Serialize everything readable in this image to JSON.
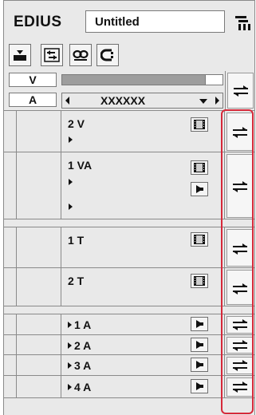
{
  "app": {
    "logo": "EDIUS",
    "sequence_name": "Untitled"
  },
  "toolbar": {
    "buttons": [
      "insert-mode-icon",
      "sync-lock-icon",
      "link-icon",
      "magnet-icon"
    ]
  },
  "source_channel": {
    "v_label": "V",
    "a_label": "A",
    "selected_source": "XXXXXX"
  },
  "tracks": [
    {
      "name": "2 V",
      "type": "V",
      "has_video_toggle": true,
      "has_audio_toggle": false
    },
    {
      "name": "1 VA",
      "type": "VA",
      "has_video_toggle": true,
      "has_audio_toggle": true
    },
    {
      "name": "1 T",
      "type": "T",
      "has_video_toggle": true,
      "has_audio_toggle": false
    },
    {
      "name": "2 T",
      "type": "T",
      "has_video_toggle": true,
      "has_audio_toggle": false
    },
    {
      "name": "1 A",
      "type": "A",
      "has_video_toggle": false,
      "has_audio_toggle": true
    },
    {
      "name": "2 A",
      "type": "A",
      "has_video_toggle": false,
      "has_audio_toggle": true
    },
    {
      "name": "3 A",
      "type": "A",
      "has_video_toggle": false,
      "has_audio_toggle": true
    },
    {
      "name": "4 A",
      "type": "A",
      "has_video_toggle": false,
      "has_audio_toggle": true
    }
  ],
  "colors": {
    "highlight": "#d6293a",
    "panel": "#e9e9e9"
  }
}
